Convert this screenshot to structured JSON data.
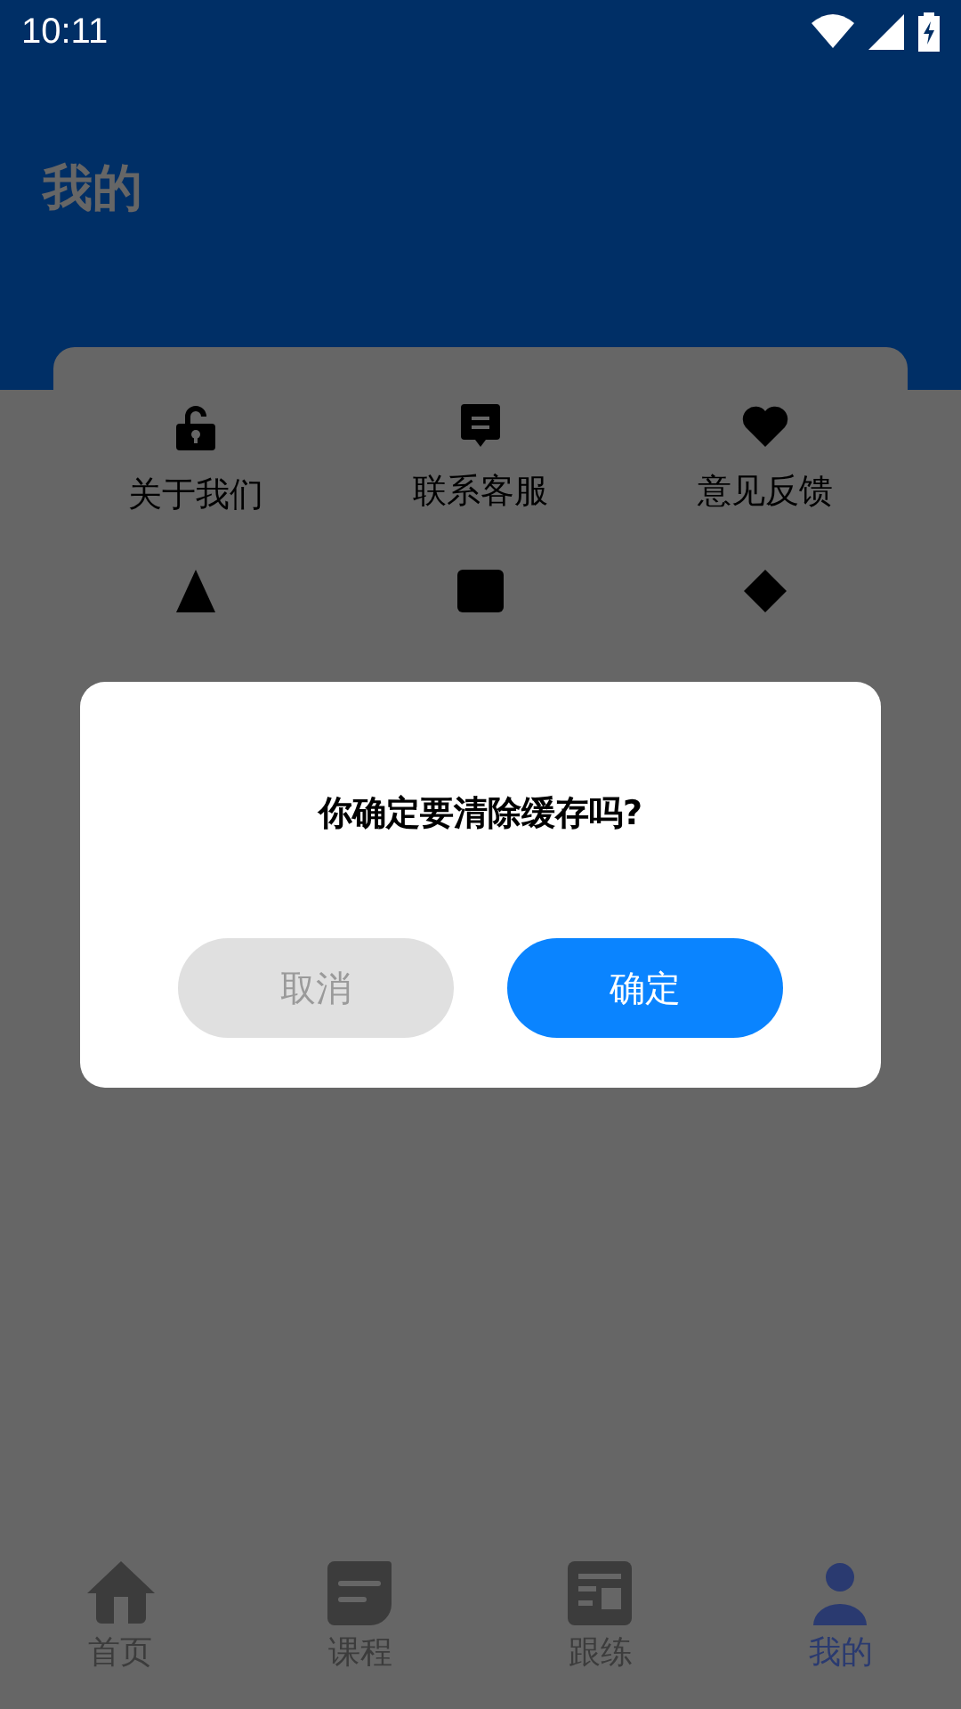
{
  "status_bar": {
    "time": "10:11"
  },
  "header": {
    "title": "我的"
  },
  "menu": [
    {
      "kind": "lock",
      "label": "关于我们"
    },
    {
      "kind": "message",
      "label": "联系客服"
    },
    {
      "kind": "heart",
      "label": "意见反馈"
    },
    {
      "kind": "peak"
    },
    {
      "kind": "square"
    },
    {
      "kind": "diamond"
    }
  ],
  "dialog": {
    "message": "你确定要清除缓存吗?",
    "buttons": [
      {
        "kind": "cancel",
        "label": "取消"
      },
      {
        "kind": "confirm",
        "label": "确定"
      }
    ]
  },
  "tabs": [
    {
      "kind": "home",
      "label": "首页",
      "selected": false
    },
    {
      "kind": "course",
      "label": "课程",
      "selected": false
    },
    {
      "kind": "practice",
      "label": "跟练",
      "selected": false
    },
    {
      "kind": "person",
      "label": "我的",
      "selected": true
    }
  ]
}
